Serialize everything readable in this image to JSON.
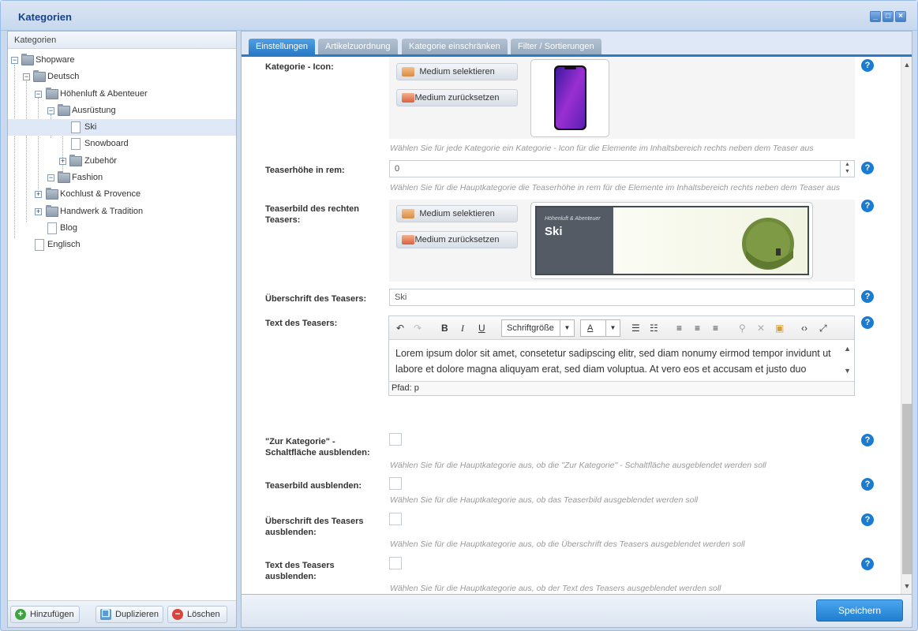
{
  "window": {
    "title": "Kategorien"
  },
  "tree": {
    "header": "Kategorien",
    "items": [
      {
        "label": "Shopware"
      },
      {
        "label": "Deutsch"
      },
      {
        "label": "Höhenluft & Abenteuer"
      },
      {
        "label": "Ausrüstung"
      },
      {
        "label": "Ski"
      },
      {
        "label": "Snowboard"
      },
      {
        "label": "Zubehör"
      },
      {
        "label": "Fashion"
      },
      {
        "label": "Kochlust & Provence"
      },
      {
        "label": "Handwerk & Tradition"
      },
      {
        "label": "Blog"
      },
      {
        "label": "Englisch"
      }
    ],
    "buttons": {
      "add": "Hinzufügen",
      "duplicate": "Duplizieren",
      "delete": "Löschen"
    }
  },
  "tabs": [
    "Einstellungen",
    "Artikelzuordnung",
    "Kategorie einschränken",
    "Filter / Sortierungen"
  ],
  "form": {
    "icon": {
      "label": "Kategorie - Icon:",
      "select": "Medium selektieren",
      "reset": "Medium zurücksetzen",
      "hint": "Wählen Sie für jede Kategorie ein Kategorie - Icon für die Elemente im Inhaltsbereich rechts neben dem Teaser aus"
    },
    "teaser_height": {
      "label": "Teaserhöhe in rem:",
      "value": "0",
      "hint": "Wählen Sie für die Hauptkategorie die Teaserhöhe in rem für die Elemente im Inhaltsbereich rechts neben dem Teaser aus"
    },
    "teaser_image": {
      "label": "Teaserbild des rechten Teasers:",
      "select": "Medium selektieren",
      "reset": "Medium zurücksetzen",
      "preview_small": "Höhenluft & Abenteuer",
      "preview_title": "Ski"
    },
    "teaser_heading": {
      "label": "Überschrift des Teasers:",
      "value": "Ski"
    },
    "teaser_text": {
      "label": "Text des Teasers:",
      "font_size": "Schriftgröße",
      "font_color_letter": "A",
      "content": "Lorem ipsum dolor sit amet, consetetur sadipscing elitr, sed diam nonumy eirmod tempor invidunt ut labore et dolore magna aliquyam erat, sed diam voluptua. At vero eos et accusam et justo duo",
      "path": "Pfad: p"
    },
    "hide_button": {
      "label": "\"Zur Kategorie\" - Schaltfläche ausblenden:",
      "hint": "Wählen Sie für die Hauptkategorie aus, ob die \"Zur Kategorie\" - Schaltfläche ausgeblendet werden soll"
    },
    "hide_image": {
      "label": "Teaserbild ausblenden:",
      "hint": "Wählen Sie für die Hauptkategorie aus, ob das Teaserbild ausgeblendet werden soll"
    },
    "hide_heading": {
      "label": "Überschrift des Teasers ausblenden:",
      "hint": "Wählen Sie für die Hauptkategorie aus, ob die Überschrift des Teasers ausgeblendet werden soll"
    },
    "hide_text": {
      "label": "Text des Teasers ausblenden:",
      "hint": "Wählen Sie für die Hauptkategorie aus, ob der Text des Teasers ausgeblendet werden soll"
    }
  },
  "help_glyph": "?",
  "footer": {
    "save": "Speichern"
  },
  "colors": {
    "accent": "#2a7ac6",
    "save": "#1f7ed0",
    "help": "#1a7bd1"
  }
}
